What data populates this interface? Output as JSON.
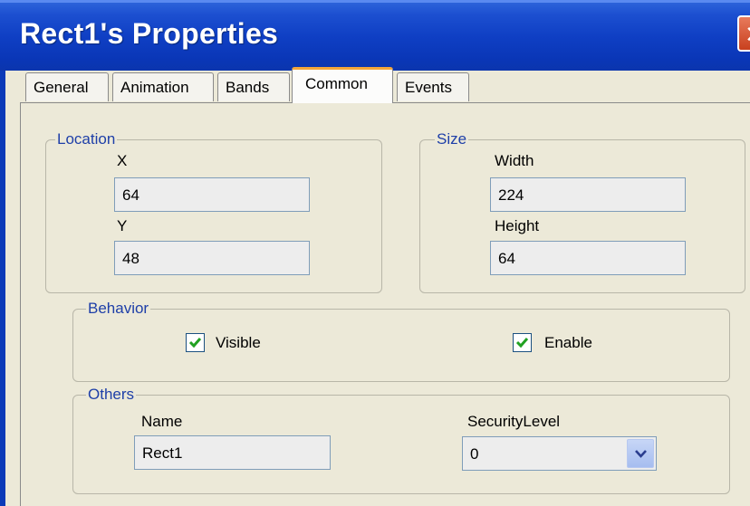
{
  "window": {
    "title": "Rect1's Properties"
  },
  "tabs": [
    {
      "label": "General"
    },
    {
      "label": "Animation"
    },
    {
      "label": "Bands"
    },
    {
      "label": "Common",
      "active": true
    },
    {
      "label": "Events"
    }
  ],
  "location": {
    "legend": "Location",
    "x_label": "X",
    "x_value": "64",
    "y_label": "Y",
    "y_value": "48"
  },
  "size": {
    "legend": "Size",
    "width_label": "Width",
    "width_value": "224",
    "height_label": "Height",
    "height_value": "64"
  },
  "behavior": {
    "legend": "Behavior",
    "visible_label": "Visible",
    "visible_checked": true,
    "enable_label": "Enable",
    "enable_checked": true
  },
  "others": {
    "legend": "Others",
    "name_label": "Name",
    "name_value": "Rect1",
    "security_label": "SecurityLevel",
    "security_value": "0"
  },
  "colors": {
    "titlebar": "#0f3fc4",
    "legend_text": "#1e3fa8",
    "tab_highlight": "#f3a63a",
    "dialog_bg": "#ece9d8"
  }
}
